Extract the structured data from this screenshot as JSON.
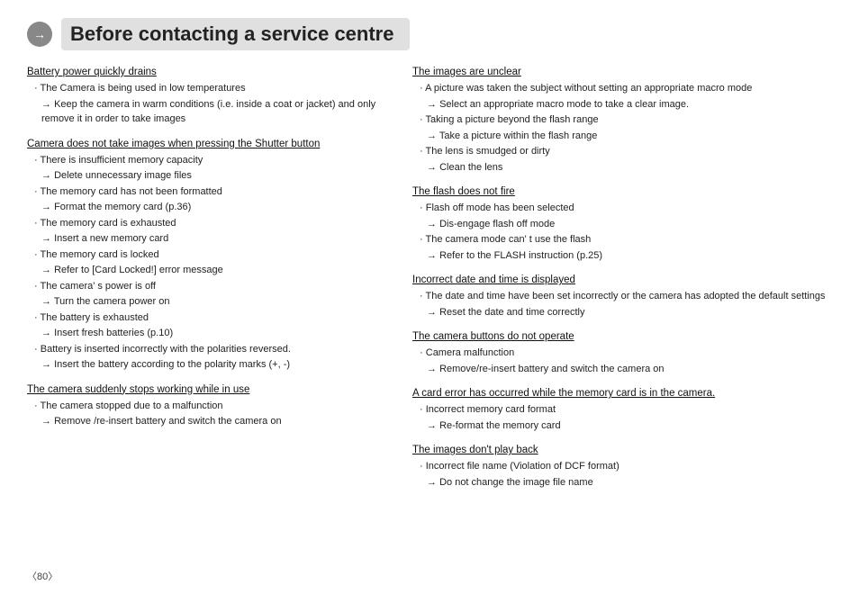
{
  "header": {
    "title": "Before contacting a service centre"
  },
  "footer": {
    "page": "〈80〉"
  },
  "left_column": {
    "sections": [
      {
        "id": "battery-drains",
        "title": "Battery power quickly drains",
        "items": [
          {
            "type": "bullet",
            "text": "The Camera is being used in low temperatures"
          },
          {
            "type": "arrow",
            "text": "Keep the camera in warm conditions (i.e. inside a coat or jacket) and only remove it in order to take images"
          }
        ]
      },
      {
        "id": "camera-no-take",
        "title": "Camera does not take images when pressing the Shutter button",
        "items": [
          {
            "type": "bullet",
            "text": "There is insufficient memory capacity"
          },
          {
            "type": "arrow",
            "text": "Delete unnecessary image files"
          },
          {
            "type": "bullet",
            "text": "The memory card has not been formatted"
          },
          {
            "type": "arrow",
            "text": "Format the memory card (p.36)"
          },
          {
            "type": "bullet",
            "text": "The memory card is exhausted"
          },
          {
            "type": "arrow",
            "text": "Insert a new memory card"
          },
          {
            "type": "bullet",
            "text": "The memory card is locked"
          },
          {
            "type": "arrow",
            "text": "Refer to [Card Locked!] error message"
          },
          {
            "type": "bullet",
            "text": "The camera' s power is off"
          },
          {
            "type": "arrow",
            "text": "Turn the camera power on"
          },
          {
            "type": "bullet",
            "text": "The battery is exhausted"
          },
          {
            "type": "arrow",
            "text": "Insert fresh batteries (p.10)"
          },
          {
            "type": "bullet",
            "text": "Battery is inserted incorrectly with the polarities reversed."
          },
          {
            "type": "arrow",
            "text": "Insert the battery according to the polarity marks (+, -)"
          }
        ]
      },
      {
        "id": "camera-stops",
        "title": "The camera suddenly stops working while in use",
        "items": [
          {
            "type": "bullet",
            "text": "The camera stopped due to a malfunction"
          },
          {
            "type": "arrow",
            "text": "Remove /re-insert battery and switch the camera on"
          }
        ]
      }
    ]
  },
  "right_column": {
    "sections": [
      {
        "id": "images-unclear",
        "title": "The images are unclear",
        "items": [
          {
            "type": "bullet",
            "text": "A picture was taken the subject without setting an appropriate macro mode"
          },
          {
            "type": "arrow",
            "text": "Select an appropriate macro mode to take a clear image."
          },
          {
            "type": "bullet",
            "text": "Taking a picture beyond the flash range"
          },
          {
            "type": "arrow",
            "text": "Take a picture within the flash range"
          },
          {
            "type": "bullet",
            "text": "The lens is smudged or dirty"
          },
          {
            "type": "arrow",
            "text": "Clean the lens"
          }
        ]
      },
      {
        "id": "flash-no-fire",
        "title": "The flash does not fire",
        "items": [
          {
            "type": "bullet",
            "text": "Flash off mode has been selected"
          },
          {
            "type": "arrow",
            "text": "Dis-engage flash off mode"
          },
          {
            "type": "bullet",
            "text": "The camera mode can' t use the flash"
          },
          {
            "type": "arrow",
            "text": "Refer to the FLASH instruction (p.25)"
          }
        ]
      },
      {
        "id": "incorrect-date",
        "title": "Incorrect date and time is displayed",
        "items": [
          {
            "type": "bullet",
            "text": "The date and time have been set incorrectly or the camera has adopted the default settings"
          },
          {
            "type": "arrow",
            "text": "→Reset the date and time correctly"
          }
        ]
      },
      {
        "id": "buttons-no-operate",
        "title": "The camera buttons do not operate",
        "items": [
          {
            "type": "bullet",
            "text": "Camera malfunction"
          },
          {
            "type": "arrow",
            "text": "Remove/re-insert battery and switch the camera on"
          }
        ]
      },
      {
        "id": "card-error",
        "title": "A card error has occurred while the memory card is in the camera.",
        "items": [
          {
            "type": "bullet",
            "text": "Incorrect memory card format"
          },
          {
            "type": "arrow",
            "text": "Re-format the memory card"
          }
        ]
      },
      {
        "id": "images-no-playback",
        "title": "The images don't play back",
        "items": [
          {
            "type": "bullet",
            "text": "Incorrect file name (Violation of DCF format)"
          },
          {
            "type": "arrow",
            "text": "Do not change the image file name"
          }
        ]
      }
    ]
  }
}
